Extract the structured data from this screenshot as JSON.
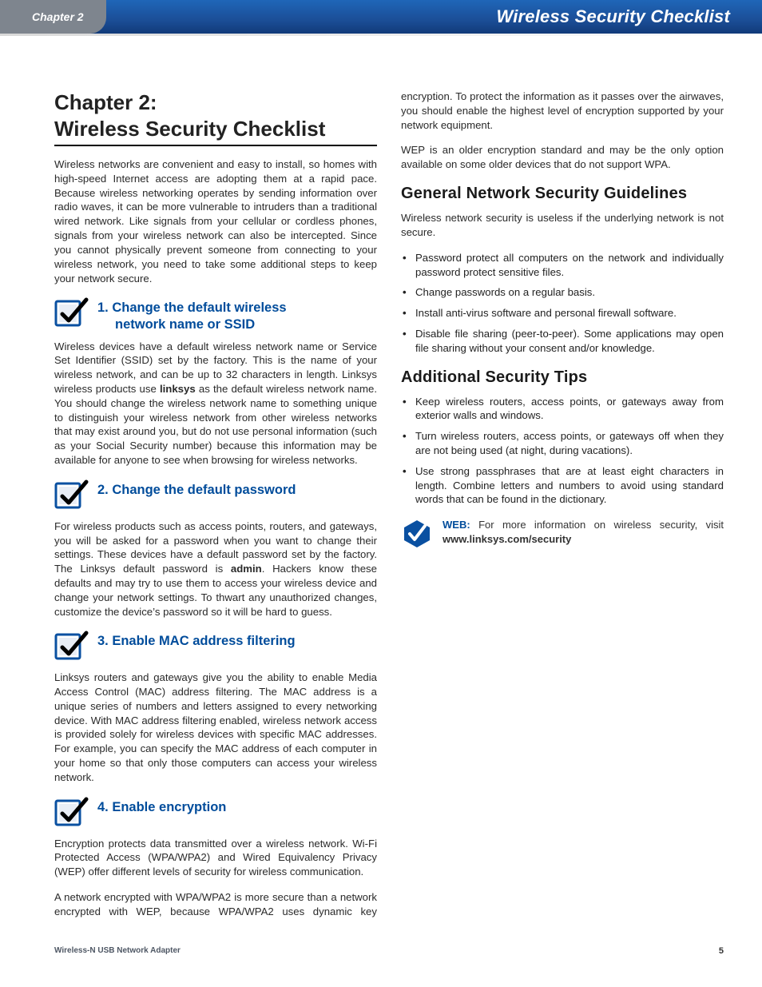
{
  "header": {
    "chapter_label": "Chapter 2",
    "doc_section": "Wireless Security Checklist"
  },
  "title_line1": "Chapter 2:",
  "title_line2": "Wireless Security Checklist",
  "intro": "Wireless networks are convenient and easy to install, so homes with high-speed Internet access are adopting them at a rapid pace. Because wireless networking operates by sending information over radio waves, it can be more vulnerable to intruders than a traditional wired network. Like signals from your cellular or cordless phones, signals from your wireless network can also be intercepted. Since you cannot physically prevent someone from connecting to your wireless network, you need to take some additional steps to keep your network secure.",
  "steps": [
    {
      "heading_a": "1.  Change the default wireless",
      "heading_b": "network name or SSID",
      "body_pre": "Wireless devices have a default wireless network name or Service Set Identifier (SSID) set by the factory. This is the name of your wireless network, and can be up to 32 characters in length. Linksys wireless products use ",
      "body_bold": "linksys",
      "body_post": " as the default wireless network name. You should change the wireless network name to something unique to distinguish your wireless network from other wireless networks that may exist around you, but do not use personal information (such as your Social Security number) because this information may be available for anyone to see when browsing for wireless networks."
    },
    {
      "heading_a": "2.  Change the default password",
      "heading_b": "",
      "body_pre": "For wireless products such as access points, routers, and gateways, you will be asked for a password when you want to change their settings. These devices have a default password set by the factory. The Linksys default password is ",
      "body_bold": "admin",
      "body_post": ". Hackers know these defaults and may try to use them to access your wireless device and change your network settings. To thwart any unauthorized changes, customize the device’s password so it will be hard to guess."
    },
    {
      "heading_a": "3.  Enable MAC address filtering",
      "heading_b": "",
      "body_pre": "Linksys routers and gateways give you the ability to enable Media Access Control (MAC) address filtering. The MAC address is a unique series of numbers and letters assigned to every networking device. With MAC address filtering enabled, wireless network access is provided solely for wireless devices with specific MAC addresses. For example, you can specify the MAC address of each computer in your home so that only those computers can access your wireless network.",
      "body_bold": "",
      "body_post": ""
    },
    {
      "heading_a": "4.  Enable encryption",
      "heading_b": "",
      "p1": "Encryption protects data transmitted over a wireless network. Wi-Fi Protected Access (WPA/WPA2) and Wired Equivalency Privacy (WEP) offer different levels of security for wireless communication.",
      "p2": "A network encrypted with WPA/WPA2 is more secure than a network encrypted with WEP, because WPA/WPA2 uses dynamic key encryption. To protect the information as it passes over the airwaves, you should enable the highest level of encryption supported by your network equipment.",
      "p3": "WEP is an older encryption standard and may be the only option available on some older devices that do not support WPA."
    }
  ],
  "general": {
    "heading": "General Network Security Guidelines",
    "lead": "Wireless network security is useless if the underlying network is not secure.",
    "items": [
      "Password protect all computers on the network and individually password protect sensitive files.",
      "Change passwords on a regular basis.",
      "Install anti-virus software and personal firewall software.",
      "Disable file sharing (peer-to-peer). Some applications may open file sharing without your consent and/or knowledge."
    ]
  },
  "additional": {
    "heading": "Additional Security Tips",
    "items": [
      "Keep wireless routers, access points, or gateways away from exterior walls and windows.",
      "Turn wireless routers, access points, or gateways off when they are not being used (at night, during vacations).",
      "Use strong passphrases that are at least eight characters in length. Combine letters and numbers to avoid using standard words that can be found in the dictionary."
    ]
  },
  "web": {
    "label": "WEB:",
    "text_pre": "For more information on wireless security, visit ",
    "link": "www.linksys.com/security"
  },
  "footer": {
    "product": "Wireless-N USB Network Adapter",
    "page": "5"
  }
}
